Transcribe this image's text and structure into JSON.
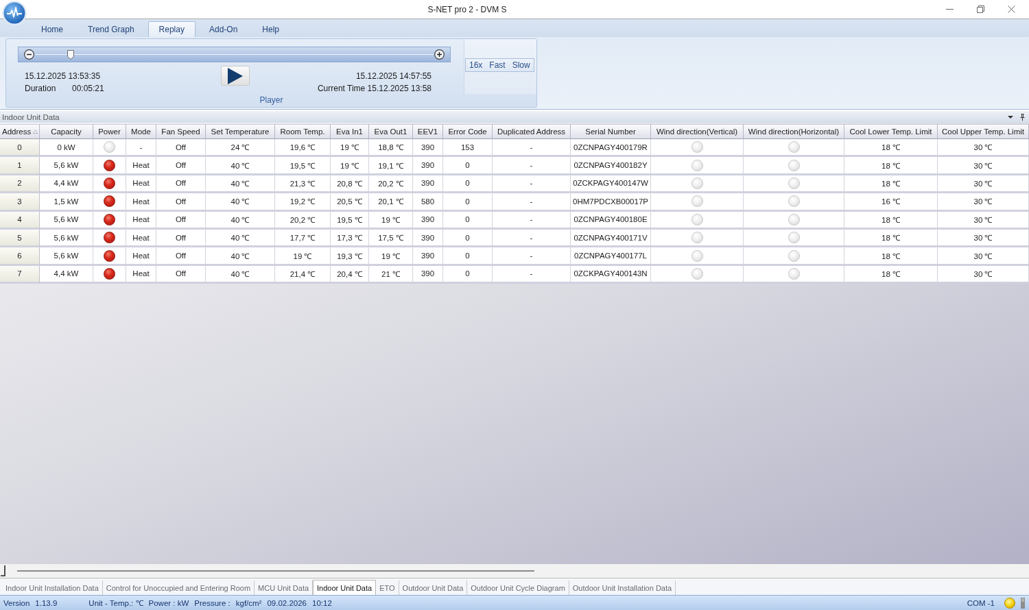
{
  "window": {
    "title": "S-NET pro 2 - DVM S"
  },
  "ribbon_tabs": [
    {
      "label": "Home",
      "selected": false
    },
    {
      "label": "Trend Graph",
      "selected": false
    },
    {
      "label": "Replay",
      "selected": true
    },
    {
      "label": "Add-On",
      "selected": false
    },
    {
      "label": "Help",
      "selected": false
    }
  ],
  "player": {
    "level": 0.09,
    "start_time": "15.12.2025 13:53:35",
    "duration_label": "Duration",
    "duration": "00:05:21",
    "end_time": "15.12.2025 14:57:55",
    "current_time": "Current Time 15.12.2025 13:58",
    "speed_buttons": [
      "16x",
      "Fast",
      "Slow"
    ],
    "group_label": "Player"
  },
  "panel": {
    "title": "Indoor Unit Data"
  },
  "table": {
    "columns": [
      {
        "label": "Address",
        "kind": "row_header",
        "sorted": true
      },
      {
        "label": "Capacity",
        "kind": "text",
        "sorted": false
      },
      {
        "label": "Power",
        "kind": "lamp",
        "sorted": false
      },
      {
        "label": "Mode",
        "kind": "text",
        "sorted": false
      },
      {
        "label": "Fan Speed",
        "kind": "text",
        "sorted": false
      },
      {
        "label": "Set Temperature",
        "kind": "text",
        "sorted": false
      },
      {
        "label": "Room Temp.",
        "kind": "text",
        "sorted": false
      },
      {
        "label": "Eva In1",
        "kind": "text",
        "sorted": false
      },
      {
        "label": "Eva Out1",
        "kind": "text",
        "sorted": false
      },
      {
        "label": "EEV1",
        "kind": "text",
        "sorted": false
      },
      {
        "label": "Error Code",
        "kind": "text",
        "sorted": false
      },
      {
        "label": "Duplicated Address",
        "kind": "text",
        "sorted": false
      },
      {
        "label": "Serial Number",
        "kind": "text",
        "sorted": false
      },
      {
        "label": "Wind direction(Vertical)",
        "kind": "lamp",
        "sorted": false
      },
      {
        "label": "Wind direction(Horizontal)",
        "kind": "lamp",
        "sorted": false
      },
      {
        "label": "Cool Lower Temp. Limit",
        "kind": "text",
        "sorted": false
      },
      {
        "label": "Cool Upper Temp. Limit",
        "kind": "text",
        "sorted": false
      }
    ],
    "rows": [
      {
        "cells": [
          "0",
          "0 kW",
          {
            "on": false
          },
          "-",
          "Off",
          "24 ℃",
          "19,6 ℃",
          "19 ℃",
          "18,8 ℃",
          "390",
          "153",
          "-",
          "0ZCNPAGY400179R",
          {
            "on": false
          },
          {
            "on": false
          },
          "18 ℃",
          "30 ℃"
        ]
      },
      {
        "cells": [
          "1",
          "5,6 kW",
          {
            "on": true
          },
          "Heat",
          "Off",
          "40 ℃",
          "19,5 ℃",
          "19 ℃",
          "19,1 ℃",
          "390",
          "0",
          "-",
          "0ZCNPAGY400182Y",
          {
            "on": false
          },
          {
            "on": false
          },
          "18 ℃",
          "30 ℃"
        ]
      },
      {
        "cells": [
          "2",
          "4,4 kW",
          {
            "on": true
          },
          "Heat",
          "Off",
          "40 ℃",
          "21,3 ℃",
          "20,8 ℃",
          "20,2 ℃",
          "390",
          "0",
          "-",
          "0ZCKPAGY400147W",
          {
            "on": false
          },
          {
            "on": false
          },
          "18 ℃",
          "30 ℃"
        ]
      },
      {
        "cells": [
          "3",
          "1,5 kW",
          {
            "on": true
          },
          "Heat",
          "Off",
          "40 ℃",
          "19,2 ℃",
          "20,5 ℃",
          "20,1 ℃",
          "580",
          "0",
          "-",
          "0HM7PDCXB00017P",
          {
            "on": false
          },
          {
            "on": false
          },
          "16 ℃",
          "30 ℃"
        ]
      },
      {
        "cells": [
          "4",
          "5,6 kW",
          {
            "on": true
          },
          "Heat",
          "Off",
          "40 ℃",
          "20,2 ℃",
          "19,5 ℃",
          "19 ℃",
          "390",
          "0",
          "-",
          "0ZCNPAGY400180E",
          {
            "on": false
          },
          {
            "on": false
          },
          "18 ℃",
          "30 ℃"
        ]
      },
      {
        "cells": [
          "5",
          "5,6 kW",
          {
            "on": true
          },
          "Heat",
          "Off",
          "40 ℃",
          "17,7 ℃",
          "17,3 ℃",
          "17,5 ℃",
          "390",
          "0",
          "-",
          "0ZCNPAGY400171V",
          {
            "on": false
          },
          {
            "on": false
          },
          "18 ℃",
          "30 ℃"
        ]
      },
      {
        "cells": [
          "6",
          "5,6 kW",
          {
            "on": true
          },
          "Heat",
          "Off",
          "40 ℃",
          "19 ℃",
          "19,3 ℃",
          "19 ℃",
          "390",
          "0",
          "-",
          "0ZCNPAGY400177L",
          {
            "on": false
          },
          {
            "on": false
          },
          "18 ℃",
          "30 ℃"
        ]
      },
      {
        "cells": [
          "7",
          "4,4 kW",
          {
            "on": true
          },
          "Heat",
          "Off",
          "40 ℃",
          "21,4 ℃",
          "20,4 ℃",
          "21 ℃",
          "390",
          "0",
          "-",
          "0ZCKPAGY400143N",
          {
            "on": false
          },
          {
            "on": false
          },
          "18 ℃",
          "30 ℃"
        ]
      }
    ]
  },
  "bottom_tabs": [
    {
      "label": "Indoor Unit Installation Data",
      "selected": false
    },
    {
      "label": "Control for Unoccupied and Entering Room",
      "selected": false
    },
    {
      "label": "MCU Unit Data",
      "selected": false
    },
    {
      "label": "Indoor Unit Data",
      "selected": true
    },
    {
      "label": "ETO",
      "selected": false
    },
    {
      "label": "Outdoor Unit Data",
      "selected": false
    },
    {
      "label": "Outdoor Unit Cycle Diagram",
      "selected": false
    },
    {
      "label": "Outdoor Unit Installation Data",
      "selected": false
    }
  ],
  "status_bar": {
    "version_label": "Version",
    "version": "1.13.9",
    "temperature_unit": "Unit - Temp.: ℃",
    "power_unit": "Power : kW",
    "pressure_label": "Pressure :",
    "pressure_unit": "kgf/cm²",
    "date": "09.02.2026",
    "time": "10:12",
    "port": "COM -1"
  }
}
